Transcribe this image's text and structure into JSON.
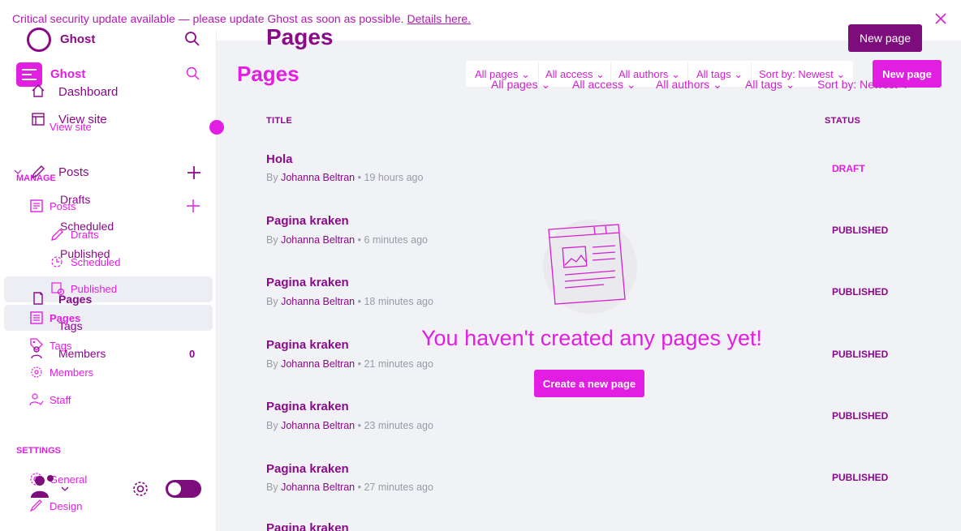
{
  "banner": {
    "text": "Critical security update available — please update Ghost as soon as possible.",
    "link": "Details here."
  },
  "sidebar": {
    "brand_a": "Ghost",
    "brand_b": "Ghost",
    "dashboard": "Dashboard",
    "view_site_a": "View site",
    "view_site_b": "View site",
    "manage": "MANAGE",
    "posts_a": "Posts",
    "posts_b": "Posts",
    "drafts_a": "Drafts",
    "drafts_b": "Drafts",
    "scheduled_a": "Scheduled",
    "scheduled_b": "Scheduled",
    "published_a": "Published",
    "published_b": "Published",
    "pages_a": "Pages",
    "pages_b": "Pages",
    "tags_a": "Tags",
    "tags_b": "Tags",
    "members_a": "Members",
    "members_b": "Members",
    "members_count": "0",
    "staff": "Staff",
    "settings": "SETTINGS",
    "general": "General",
    "design": "Design"
  },
  "main": {
    "title_a": "Pages",
    "title_b": "Pages",
    "new_page_a": "New page",
    "new_page_b": "New page",
    "filters_a": [
      "All pages",
      "All access",
      "All authors",
      "All tags",
      "Sort by: Newest"
    ],
    "filters_b": [
      "All pages",
      "All access",
      "All authors",
      "All tags",
      "Sort by: Newest"
    ],
    "col_title": "TITLE",
    "col_status": "STATUS",
    "rows": [
      {
        "title": "Hola",
        "by": "By",
        "author": "Johanna Beltran",
        "time": "• 19 hours ago",
        "status": "DRAFT"
      },
      {
        "title": "Pagina kraken",
        "by": "By",
        "author": "Johanna Beltran",
        "time": "• 6 minutes ago",
        "status": "PUBLISHED"
      },
      {
        "title": "Pagina kraken",
        "by": "By",
        "author": "Johanna Beltran",
        "time": "• 18 minutes ago",
        "status": "PUBLISHED"
      },
      {
        "title": "Pagina kraken",
        "by": "By",
        "author": "Johanna Beltran",
        "time": "• 21 minutes ago",
        "status": "PUBLISHED"
      },
      {
        "title": "Pagina kraken",
        "by": "By",
        "author": "Johanna Beltran",
        "time": "• 23 minutes ago",
        "status": "PUBLISHED"
      },
      {
        "title": "Pagina kraken",
        "by": "By",
        "author": "Johanna Beltran",
        "time": "• 27 minutes ago",
        "status": "PUBLISHED"
      },
      {
        "title": "Pagina kraken"
      }
    ],
    "empty_message": "You haven't created any pages yet!",
    "empty_button": "Create a new page"
  },
  "colors": {
    "accent": "#e21ee2",
    "brand_dark": "#8a0a8a",
    "background": "#f1f2f6"
  },
  "icons": [
    "search-icon",
    "home-icon",
    "view-site-icon",
    "posts-icon",
    "plus-icon",
    "pencil-icon",
    "clock-icon",
    "published-icon",
    "page-icon",
    "tag-icon",
    "members-icon",
    "staff-icon",
    "settings-icon",
    "design-icon",
    "close-icon",
    "chevron-down-icon",
    "avatar-icon",
    "gear-icon"
  ]
}
